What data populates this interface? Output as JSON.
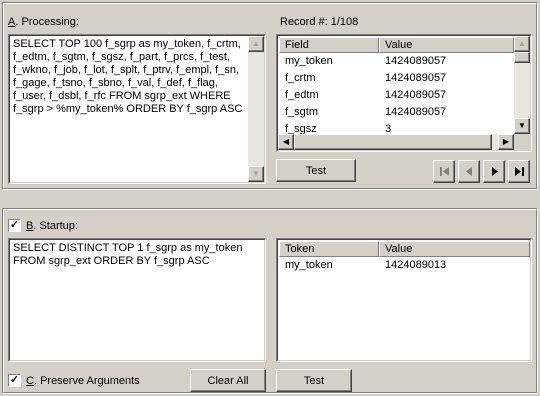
{
  "processing": {
    "label_key": "A",
    "label_rest": ". Processing:",
    "sql": "SELECT TOP 100 f_sgrp as my_token, f_crtm, f_edtm, f_sgtm, f_sgsz, f_part, f_prcs, f_test, f_wkno, f_job, f_lot, f_splt, f_ptrv, f_empl, f_sn, f_gage, f_tsno, f_sbno, f_val, f_def, f_flag, f_user, f_dsbl, f_rfc FROM sgrp_ext WHERE f_sgrp > %my_token% ORDER BY f_sgrp ASC"
  },
  "record": {
    "label": "Record #: 1/108",
    "columns": [
      "Field",
      "Value"
    ],
    "rows": [
      {
        "field": "my_token",
        "value": "1424089057"
      },
      {
        "field": "f_crtm",
        "value": "1424089057"
      },
      {
        "field": "f_edtm",
        "value": "1424089057"
      },
      {
        "field": "f_sgtm",
        "value": "1424089057"
      },
      {
        "field": "f_sgsz",
        "value": "3"
      }
    ],
    "test_label": "Test",
    "nav": [
      "first-record-icon",
      "previous-record-icon",
      "next-record-icon",
      "last-record-icon"
    ]
  },
  "startup": {
    "checked": true,
    "label_key": "B",
    "label_rest": ". Startup:",
    "sql": "SELECT DISTINCT TOP 1 f_sgrp as my_token FROM sgrp_ext ORDER BY f_sgrp ASC",
    "columns": [
      "Token",
      "Value"
    ],
    "rows": [
      {
        "token": "my_token",
        "value": "1424089013"
      }
    ],
    "test_label": "Test"
  },
  "preserve": {
    "checked": true,
    "label_key": "C",
    "label_rest": ". Preserve Arguments",
    "clear_label": "Clear All"
  }
}
